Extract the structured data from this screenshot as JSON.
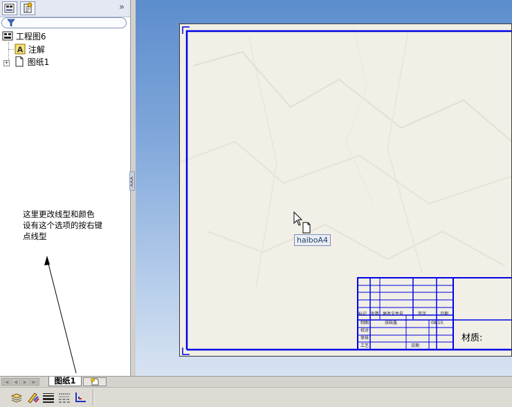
{
  "feature_tree": {
    "tabs": [
      "feature-manager-tab",
      "property-manager-tab"
    ],
    "expand_label": "»",
    "items": [
      {
        "label": "工程图6",
        "icon": "drawing-icon"
      },
      {
        "label": "注解",
        "icon": "annotation-icon"
      },
      {
        "label": "图纸1",
        "icon": "sheet-icon"
      }
    ]
  },
  "annotation_note": {
    "lines": [
      "这里更改线型和颜色",
      "设有这个选项的按右键",
      "点线型"
    ]
  },
  "sheet_tabs": {
    "active": "图纸1",
    "add_icon": "add-sheet-icon"
  },
  "toolbar": {
    "icons": [
      "layer-icon",
      "line-color-icon",
      "line-thickness-icon",
      "line-style-icon",
      "line-format-icon"
    ]
  },
  "drawing": {
    "tooltip": "haiboA4",
    "material_label": "材质:",
    "title_block": {
      "row_labels": [
        "标记",
        "处数",
        "更改文件号",
        "签字",
        "日期"
      ],
      "names": [
        "制图",
        "校对",
        "审核",
        "工艺"
      ],
      "drafter": "张晗鑫",
      "date_short": "日期",
      "date_value": "08.10."
    }
  },
  "colors": {
    "border_blue": "#0000e6",
    "paper": "#f1efe6",
    "background_top": "#5c8dcc"
  }
}
